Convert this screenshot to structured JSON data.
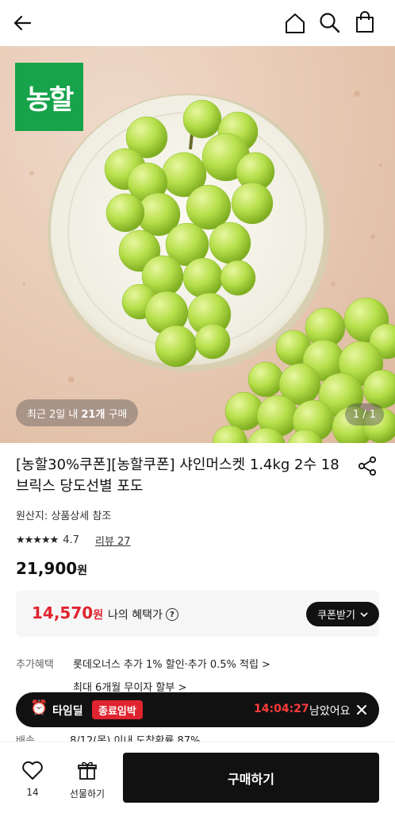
{
  "header": {
    "back_icon": "arrow-left-icon",
    "home_icon": "home-icon",
    "search_icon": "search-icon",
    "cart_icon": "shopping-bag-icon"
  },
  "hero": {
    "brand_logo": "농할",
    "recent_prefix": "최근 2일 내",
    "recent_count": "21개",
    "recent_suffix": "구매",
    "image_counter": "1 / 1"
  },
  "product": {
    "title": "[농할30%쿠폰][농할쿠폰] 샤인머스켓 1.4kg 2수 18브릭스 당도선별 포도",
    "origin": "원산지: 상품상세 참조",
    "stars": "★★★★★",
    "rating": "4.7",
    "reviews": "리뷰 27",
    "price": "21,900",
    "price_unit": "원"
  },
  "benefit": {
    "price": "14,570",
    "unit": "원",
    "label": "나의 혜택가",
    "coupon_button": "쿠폰받기"
  },
  "extra_benefits": {
    "label": "추가혜택",
    "line1": "롯데오너스 추가 1% 할인·추가 0.5% 적립 >",
    "line2": "최대 6개월 무이자 할부 >"
  },
  "timedeal": {
    "label": "타임딜",
    "badge": "종료임박",
    "timer": "14:04:27",
    "suffix": "남았어요"
  },
  "hidden_row": {
    "label": "배송",
    "value": "8/12(목) 이내 도착확률 87%"
  },
  "bottom": {
    "wish_count": "14",
    "gift_label": "선물하기",
    "buy_label": "구매하기"
  },
  "colors": {
    "accent_red": "#e0242f",
    "brand_green": "#17a34a",
    "dark": "#111111"
  }
}
